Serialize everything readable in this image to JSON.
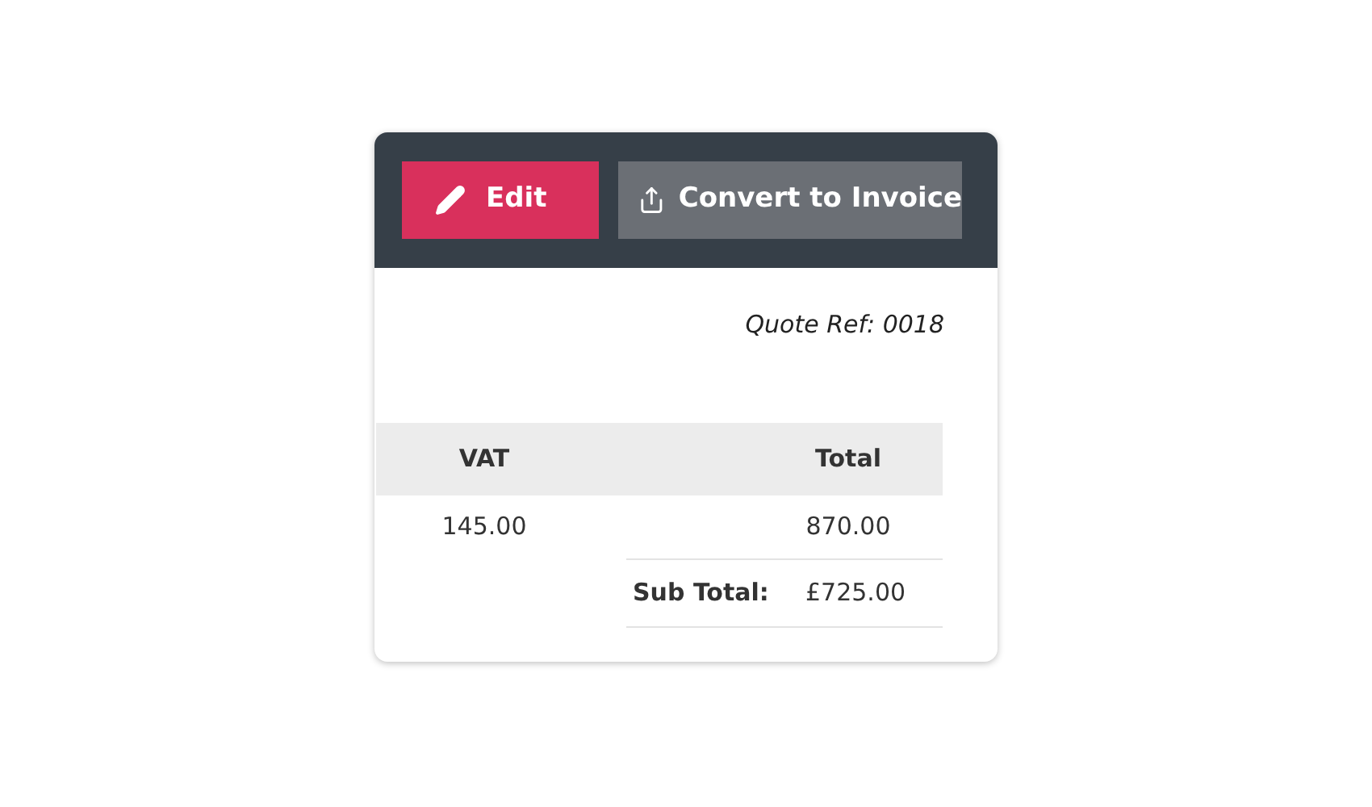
{
  "toolbar": {
    "buttons": [
      {
        "kind": "edit",
        "label": "Edit"
      },
      {
        "kind": "convert",
        "label": "Convert to Invoice"
      }
    ]
  },
  "quote_ref": "Quote Ref: 0018",
  "table": {
    "columns": [
      "VAT",
      "Total"
    ],
    "rows": [
      [
        "145.00",
        "870.00"
      ]
    ]
  },
  "subtotal": {
    "label": "Sub Total:",
    "value": "£725.00"
  }
}
